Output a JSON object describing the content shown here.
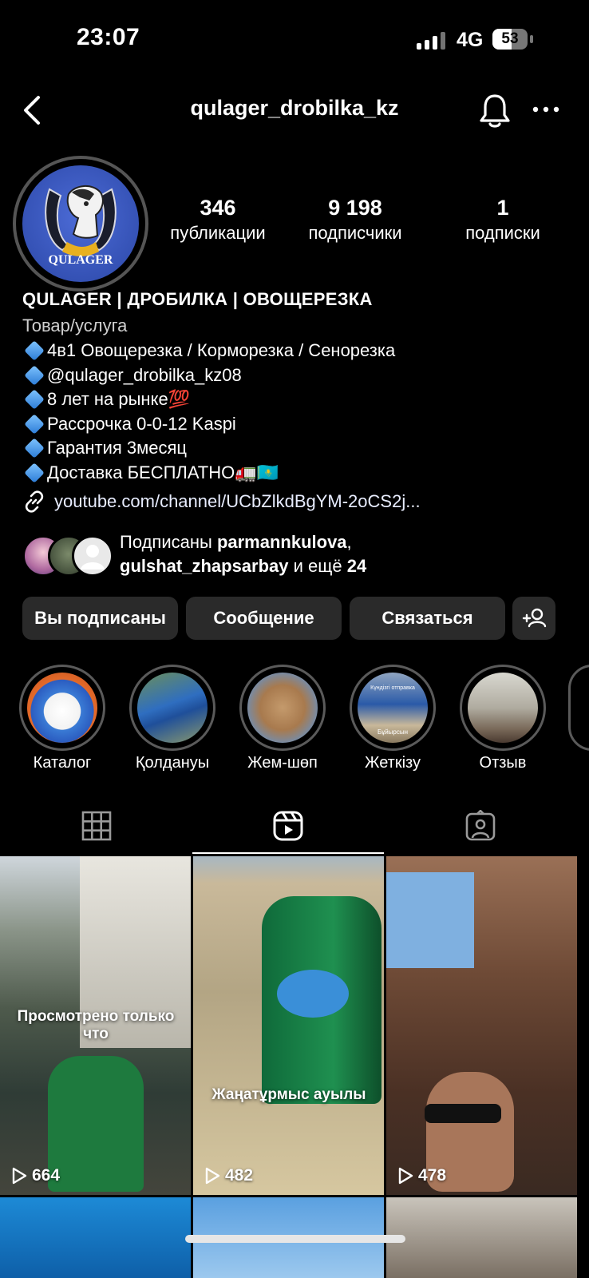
{
  "status_bar": {
    "time": "23:07",
    "network": "4G",
    "battery": "53"
  },
  "header": {
    "username": "qulager_drobilka_kz"
  },
  "profile": {
    "avatar_text": "QULAGER",
    "stats": [
      {
        "value": "346",
        "label": "публикации"
      },
      {
        "value": "9 198",
        "label": "подписчики"
      },
      {
        "value": "1",
        "label": "подписки"
      }
    ],
    "name": "QULAGER | ДРОБИЛКА | ОВОЩЕРЕЗКА",
    "category": "Товар/услуга",
    "bio_lines": [
      "4в1 Овощерезка / Корморезка / Сенорезка",
      "@qulager_drobilka_kz08",
      "8 лет на рынке💯",
      "Рассрочка 0-0-12 Kaspi",
      "Гарантия 3месяц",
      "Доставка БЕСПЛАТНО🚛🇰🇿"
    ],
    "link": "youtube.com/channel/UCbZlkdBgYM-2oCS2j..."
  },
  "followed_by": {
    "prefix": "Подписаны",
    "user1": "parmannkulova",
    "sep": ",",
    "user2": "gulshat_zhapsarbay",
    "middle": "и ещё",
    "count": "24"
  },
  "actions": {
    "following": "Вы подписаны",
    "message": "Сообщение",
    "contact": "Связаться"
  },
  "highlights": [
    "Каталог",
    "Қолдануы",
    "Жем-шөп",
    "Жеткізу",
    "Отзыв"
  ],
  "highlight_texts": [
    "Күндізгі отправка",
    "Бұйырсын"
  ],
  "posts": [
    {
      "overlay": "Просмотрено только что",
      "views": "664"
    },
    {
      "overlay": "Жаңатұрмыс ауылы",
      "views": "482"
    },
    {
      "overlay": "",
      "views": "478"
    }
  ],
  "colors": {
    "background": "#000000",
    "button": "#2a2a2a",
    "accent_blue": "#3b5bd0"
  }
}
